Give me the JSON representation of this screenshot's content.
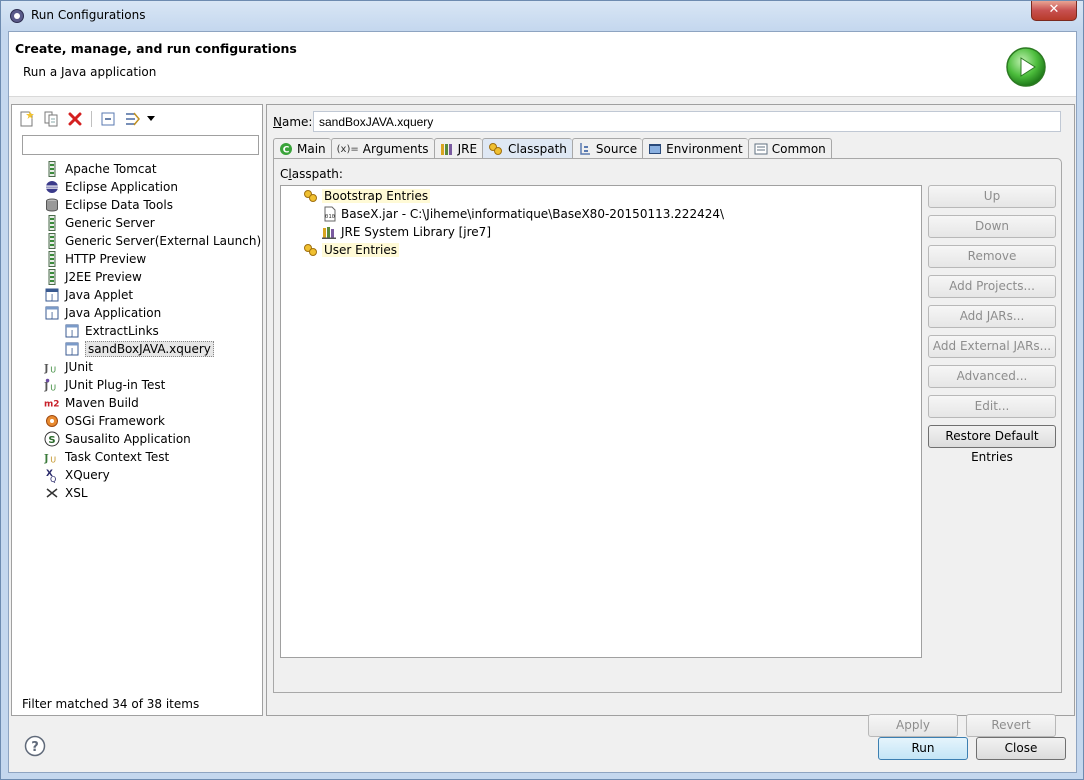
{
  "window": {
    "title": "Run Configurations",
    "close_label": "✕"
  },
  "banner": {
    "title": "Create, manage, and run configurations",
    "subtitle": "Run a Java application"
  },
  "left": {
    "filter_value": "",
    "tree": [
      {
        "label": "Apache Tomcat",
        "icon": "server-icon",
        "level": 0
      },
      {
        "label": "Eclipse Application",
        "icon": "eclipse-icon",
        "level": 0
      },
      {
        "label": "Eclipse Data Tools",
        "icon": "database-icon",
        "level": 0
      },
      {
        "label": "Generic Server",
        "icon": "server-icon",
        "level": 0
      },
      {
        "label": "Generic Server(External Launch)",
        "icon": "server-icon",
        "level": 0
      },
      {
        "label": "HTTP Preview",
        "icon": "server-icon",
        "level": 0
      },
      {
        "label": "J2EE Preview",
        "icon": "server-icon",
        "level": 0
      },
      {
        "label": "Java Applet",
        "icon": "applet-icon",
        "level": 0
      },
      {
        "label": "Java Application",
        "icon": "java-app-icon",
        "level": 0
      },
      {
        "label": "ExtractLinks",
        "icon": "java-app-icon",
        "level": 1
      },
      {
        "label": "sandBoxJAVA.xquery",
        "icon": "java-app-icon",
        "level": 1,
        "selected": true
      },
      {
        "label": "JUnit",
        "icon": "junit-icon",
        "level": 0
      },
      {
        "label": "JUnit Plug-in Test",
        "icon": "junit-plugin-icon",
        "level": 0
      },
      {
        "label": "Maven Build",
        "icon": "maven-icon",
        "level": 0
      },
      {
        "label": "OSGi Framework",
        "icon": "osgi-icon",
        "level": 0
      },
      {
        "label": "Sausalito Application",
        "icon": "sausalito-icon",
        "level": 0
      },
      {
        "label": "Task Context Test",
        "icon": "task-test-icon",
        "level": 0
      },
      {
        "label": "XQuery",
        "icon": "xquery-icon",
        "level": 0
      },
      {
        "label": "XSL",
        "icon": "xsl-icon",
        "level": 0
      }
    ],
    "filter_status": "Filter matched 34 of 38 items"
  },
  "right": {
    "name_label": "Name:",
    "name_value": "sandBoxJAVA.xquery",
    "tabs": [
      "Main",
      "Arguments",
      "JRE",
      "Classpath",
      "Source",
      "Environment",
      "Common"
    ],
    "active_tab": "Classpath",
    "classpath_label": "Classpath:",
    "classpath_tree": [
      {
        "label": "Bootstrap Entries",
        "type": "group",
        "level": 0
      },
      {
        "label": "BaseX.jar - C:\\Jiheme\\informatique\\BaseX80-20150113.222424\\",
        "type": "jar",
        "level": 1
      },
      {
        "label": "JRE System Library [jre7]",
        "type": "library",
        "level": 1
      },
      {
        "label": "User Entries",
        "type": "group",
        "level": 0
      }
    ],
    "side_buttons": [
      "Up",
      "Down",
      "Remove",
      "Add Projects...",
      "Add JARs...",
      "Add External JARs...",
      "Advanced...",
      "Edit...",
      "Restore Default Entries"
    ],
    "apply_label": "Apply",
    "revert_label": "Revert"
  },
  "footer": {
    "run_label": "Run",
    "close_label": "Close"
  },
  "colors": {
    "group_highlight": "#fffad6",
    "disabled_text": "#8d8d8d",
    "run_green": "#3aa33a"
  }
}
